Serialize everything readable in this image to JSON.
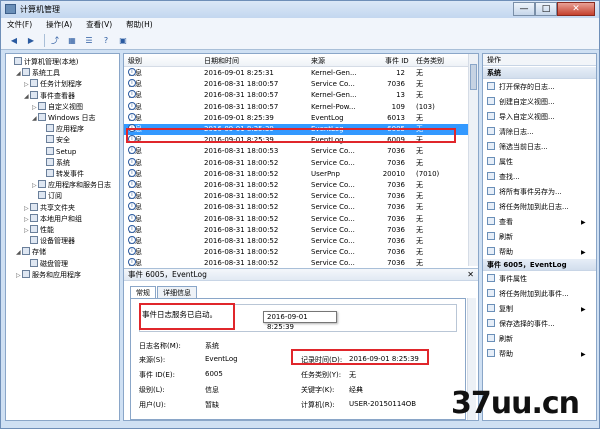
{
  "window": {
    "title": "计算机管理",
    "buttons": {
      "minimize": "—",
      "maximize": "□",
      "close": "✕"
    }
  },
  "menu": [
    "文件(F)",
    "操作(A)",
    "查看(V)",
    "帮助(H)"
  ],
  "toolbar": [
    "back-icon",
    "forward-icon",
    "up-icon",
    "show-hide-tree-icon",
    "properties-icon",
    "help-icon",
    "export-icon"
  ],
  "tree": [
    {
      "label": "计算机管理(本地)",
      "level": 0,
      "expander": ""
    },
    {
      "label": "系统工具",
      "level": 1,
      "expander": "◢"
    },
    {
      "label": "任务计划程序",
      "level": 2,
      "expander": "▷"
    },
    {
      "label": "事件查看器",
      "level": 2,
      "expander": "◢"
    },
    {
      "label": "自定义视图",
      "level": 3,
      "expander": "▷"
    },
    {
      "label": "Windows 日志",
      "level": 3,
      "expander": "◢"
    },
    {
      "label": "应用程序",
      "level": 4,
      "expander": ""
    },
    {
      "label": "安全",
      "level": 4,
      "expander": ""
    },
    {
      "label": "Setup",
      "level": 4,
      "expander": ""
    },
    {
      "label": "系统",
      "level": 4,
      "expander": ""
    },
    {
      "label": "转发事件",
      "level": 4,
      "expander": ""
    },
    {
      "label": "应用程序和服务日志",
      "level": 3,
      "expander": "▷"
    },
    {
      "label": "订阅",
      "level": 3,
      "expander": ""
    },
    {
      "label": "共享文件夹",
      "level": 2,
      "expander": "▷"
    },
    {
      "label": "本地用户和组",
      "level": 2,
      "expander": "▷"
    },
    {
      "label": "性能",
      "level": 2,
      "expander": "▷"
    },
    {
      "label": "设备管理器",
      "level": 2,
      "expander": ""
    },
    {
      "label": "存储",
      "level": 1,
      "expander": "◢"
    },
    {
      "label": "磁盘管理",
      "level": 2,
      "expander": ""
    },
    {
      "label": "服务和应用程序",
      "level": 1,
      "expander": "▷"
    }
  ],
  "grid": {
    "columns": [
      "级别",
      "日期和时间",
      "来源",
      "事件 ID",
      "任务类别"
    ],
    "rows": [
      {
        "level": "信息",
        "datetime": "2016-09-01 8:25:31",
        "source": "Kernel-Gen...",
        "id": "12",
        "category": "无"
      },
      {
        "level": "信息",
        "datetime": "2016-08-31 18:00:57",
        "source": "Service Co...",
        "id": "7036",
        "category": "无"
      },
      {
        "level": "信息",
        "datetime": "2016-08-31 18:00:57",
        "source": "Kernel-Gen...",
        "id": "13",
        "category": "无"
      },
      {
        "level": "信息",
        "datetime": "2016-08-31 18:00:57",
        "source": "Kernel-Pow...",
        "id": "109",
        "category": "(103)"
      },
      {
        "level": "信息",
        "datetime": "2016-09-01 8:25:39",
        "source": "EventLog",
        "id": "6013",
        "category": "无"
      },
      {
        "level": "信息",
        "datetime": "2016-09-01 8:25:39",
        "source": "EventLog",
        "id": "6005",
        "category": "无"
      },
      {
        "level": "信息",
        "datetime": "2016-09-01 8:25:39",
        "source": "EventLog",
        "id": "6009",
        "category": "无"
      },
      {
        "level": "信息",
        "datetime": "2016-08-31 18:00:53",
        "source": "Service Co...",
        "id": "7036",
        "category": "无"
      },
      {
        "level": "信息",
        "datetime": "2016-08-31 18:00:52",
        "source": "Service Co...",
        "id": "7036",
        "category": "无"
      },
      {
        "level": "信息",
        "datetime": "2016-08-31 18:00:52",
        "source": "UserPnp",
        "id": "20010",
        "category": "(7010)"
      },
      {
        "level": "信息",
        "datetime": "2016-08-31 18:00:52",
        "source": "Service Co...",
        "id": "7036",
        "category": "无"
      },
      {
        "level": "信息",
        "datetime": "2016-08-31 18:00:52",
        "source": "Service Co...",
        "id": "7036",
        "category": "无"
      },
      {
        "level": "信息",
        "datetime": "2016-08-31 18:00:52",
        "source": "Service Co...",
        "id": "7036",
        "category": "无"
      },
      {
        "level": "信息",
        "datetime": "2016-08-31 18:00:52",
        "source": "Service Co...",
        "id": "7036",
        "category": "无"
      },
      {
        "level": "信息",
        "datetime": "2016-08-31 18:00:52",
        "source": "Service Co...",
        "id": "7036",
        "category": "无"
      },
      {
        "level": "信息",
        "datetime": "2016-08-31 18:00:52",
        "source": "Service Co...",
        "id": "7036",
        "category": "无"
      },
      {
        "level": "信息",
        "datetime": "2016-08-31 18:00:52",
        "source": "Service Co...",
        "id": "7036",
        "category": "无"
      },
      {
        "level": "信息",
        "datetime": "2016-08-31 18:00:52",
        "source": "Service Co...",
        "id": "7036",
        "category": "无"
      }
    ],
    "selected_index": 5
  },
  "detail": {
    "title": "事件 6005，EventLog",
    "close": "✕",
    "tabs": [
      "常规",
      "详细信息"
    ],
    "message": "事件日志服务已启动。",
    "fields": {
      "log_name_label": "日志名称(M):",
      "log_name": "系统",
      "source_label": "来源(S):",
      "source": "EventLog",
      "logged_label": "记录时间(D):",
      "logged": "2016-09-01 8:25:39",
      "event_id_label": "事件 ID(E):",
      "event_id": "6005",
      "category_label": "任务类别(Y):",
      "category": "无",
      "level_label": "级别(L):",
      "level": "信息",
      "keywords_label": "关键字(K):",
      "keywords": "经典",
      "user_label": "用户(U):",
      "user": "暂缺",
      "computer_label": "计算机(R):",
      "computer": "USER-20150114OB"
    },
    "tooltip": "2016-09-01 8:25:39"
  },
  "actions": {
    "header": "操作",
    "section1": "系统",
    "items1": [
      {
        "label": "打开保存的日志...",
        "arrow": ""
      },
      {
        "label": "创建自定义视图...",
        "arrow": ""
      },
      {
        "label": "导入自定义视图...",
        "arrow": ""
      },
      {
        "label": "清除日志...",
        "arrow": ""
      },
      {
        "label": "筛选当前日志...",
        "arrow": ""
      },
      {
        "label": "属性",
        "arrow": ""
      },
      {
        "label": "查找...",
        "arrow": ""
      },
      {
        "label": "将所有事件另存为...",
        "arrow": ""
      },
      {
        "label": "将任务附加到此日志...",
        "arrow": ""
      },
      {
        "label": "查看",
        "arrow": "▶"
      },
      {
        "label": "刷新",
        "arrow": ""
      },
      {
        "label": "帮助",
        "arrow": "▶"
      }
    ],
    "section2": "事件 6005，EventLog",
    "items2": [
      {
        "label": "事件属性",
        "arrow": ""
      },
      {
        "label": "将任务附加到此事件...",
        "arrow": ""
      },
      {
        "label": "复制",
        "arrow": "▶"
      },
      {
        "label": "保存选择的事件...",
        "arrow": ""
      },
      {
        "label": "刷新",
        "arrow": ""
      },
      {
        "label": "帮助",
        "arrow": "▶"
      }
    ]
  },
  "watermark": "37uu.cn",
  "colors": {
    "selection": "#3399ff",
    "highlight": "#e0262b",
    "frame": "#cfe0f3"
  }
}
